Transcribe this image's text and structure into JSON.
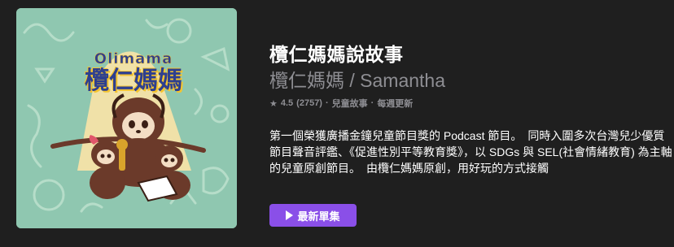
{
  "podcast": {
    "title": "欖仁媽媽說故事",
    "author": "欖仁媽媽 / Samantha",
    "rating": "4.5",
    "rating_count": "(2757)",
    "category": "兒童故事",
    "frequency": "每週更新",
    "separator": "·",
    "description": "第一個榮獲廣播金鐘兒童節目獎的 Podcast 節目。　同時入圍多次台灣兒少優質節目聲音評鑑、《促進性別平等教育獎》，以 SDGs 與 SEL(社會情緒教育) 為主軸的兒童原創節目。　由欖仁媽媽原創，用好玩的方式接觸",
    "artwork": {
      "logo_latin": "Olimama",
      "logo_cjk": "欖仁媽媽",
      "colors": {
        "background": "#8fc7b0",
        "doodle": "#b6ddc9",
        "light": "#f6e3a8",
        "sloth": "#6b3a2a",
        "face": "#f3ddc4",
        "logo_text": "#2e3f8f",
        "logo_fill": "#f4c430"
      }
    }
  },
  "actions": {
    "play_label": "最新單集",
    "play_icon": "play-icon"
  },
  "colors": {
    "background": "#1f1f1f",
    "accent": "#8a4fe8",
    "secondary_text": "#8e8e93"
  }
}
